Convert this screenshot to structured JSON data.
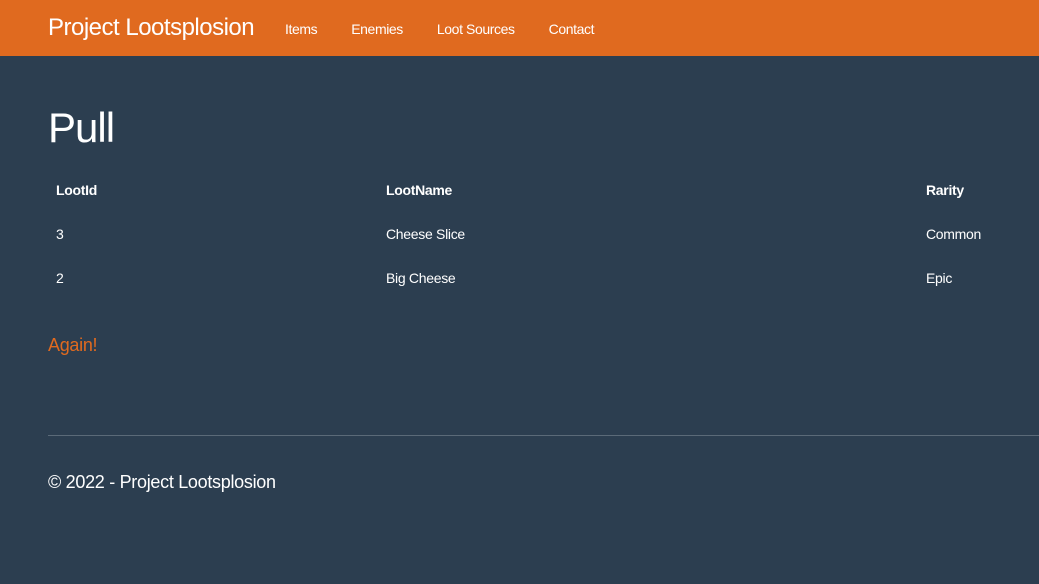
{
  "navbar": {
    "brand": "Project Lootsplosion",
    "links": [
      "Items",
      "Enemies",
      "Loot Sources",
      "Contact"
    ]
  },
  "main": {
    "title": "Pull",
    "table": {
      "headers": [
        "LootId",
        "LootName",
        "Rarity"
      ],
      "rows": [
        [
          "3",
          "Cheese Slice",
          "Common"
        ],
        [
          "2",
          "Big Cheese",
          "Epic"
        ]
      ]
    },
    "again_link": "Again!"
  },
  "footer": {
    "text": "© 2022 - Project Lootsplosion"
  },
  "colors": {
    "navbar_bg": "#e06a1f",
    "page_bg": "#2c3e50",
    "accent": "#e06a1f",
    "text": "#ffffff"
  }
}
